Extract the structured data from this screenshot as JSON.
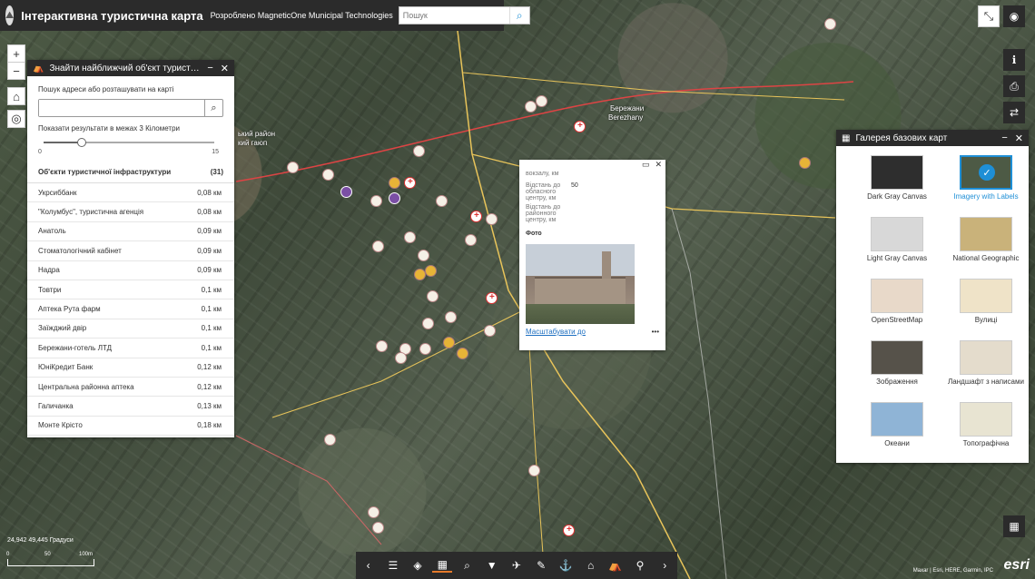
{
  "header": {
    "title": "Інтерактивна туристична карта",
    "subtitle": "Розроблено MagneticOne Municipal Technologies",
    "search_placeholder": "Пошук"
  },
  "map_labels": {
    "town_ua": "Бережани",
    "town_en": "Berezhany",
    "district": "ький район",
    "district2": "кий гаюп"
  },
  "nearby": {
    "title": "Знайти найближчий об'єкт туристи...",
    "address_label": "Пошук адреси або розташувати на карті",
    "radius_label": "Показати результати в межах 3 Кілометри",
    "slider_value": 3,
    "slider_min": "0",
    "slider_max": "15",
    "list_title": "Об'єкти туристичної інфраструктури",
    "list_count": "(31)",
    "items": [
      {
        "name": "Укрсиббанк",
        "dist": "0,08 км"
      },
      {
        "name": "\"Колумбус\", туристична агенція",
        "dist": "0,08 км"
      },
      {
        "name": "Анатоль",
        "dist": "0,09 км"
      },
      {
        "name": "Стоматологічний кабінет",
        "dist": "0,09 км"
      },
      {
        "name": "Надра",
        "dist": "0,09 км"
      },
      {
        "name": "Товтри",
        "dist": "0,1 км"
      },
      {
        "name": "Аптека Рута фарм",
        "dist": "0,1 км"
      },
      {
        "name": "Заїжджий двір",
        "dist": "0,1 км"
      },
      {
        "name": "Бережани-готель ЛТД",
        "dist": "0,1 км"
      },
      {
        "name": "ЮніКредит Банк",
        "dist": "0,12 км"
      },
      {
        "name": "Центральна районна аптека",
        "dist": "0,12 км"
      },
      {
        "name": "Галичанка",
        "dist": "0,13 км"
      },
      {
        "name": "Монте Крісто",
        "dist": "0,18 км"
      }
    ]
  },
  "popup": {
    "top_text": "вокзалу, км",
    "rows": [
      {
        "key": "Відстань до обласного центру, км",
        "value": "50"
      },
      {
        "key": "Відстань до районного центру, км",
        "value": ""
      }
    ],
    "photo_label": "Фото",
    "zoom_link": "Масштабувати до",
    "more": "•••"
  },
  "gallery": {
    "title": "Галерея базових карт",
    "items": [
      {
        "label": "Dark Gray Canvas",
        "color": "#2e2e2e"
      },
      {
        "label": "Imagery with Labels",
        "color": "#4d5a45",
        "selected": true
      },
      {
        "label": "Light Gray Canvas",
        "color": "#d8d8d8"
      },
      {
        "label": "National Geographic",
        "color": "#c9b27a"
      },
      {
        "label": "OpenStreetMap",
        "color": "#e8d9c9"
      },
      {
        "label": "Вулиці",
        "color": "#efe3c8"
      },
      {
        "label": "Зображення",
        "color": "#56524a"
      },
      {
        "label": "Ландшафт з написами",
        "color": "#e4dccc"
      },
      {
        "label": "Океани",
        "color": "#8fb4d6"
      },
      {
        "label": "Топографічна",
        "color": "#e8e4d2"
      }
    ]
  },
  "footer": {
    "coords": "24,942 49,445 Градуси",
    "scale_left": "0",
    "scale_mid": "50",
    "scale_right": "100m",
    "attribution": "Maxar | Esri, HERE, Garmin, IPC",
    "esri": "esri"
  }
}
